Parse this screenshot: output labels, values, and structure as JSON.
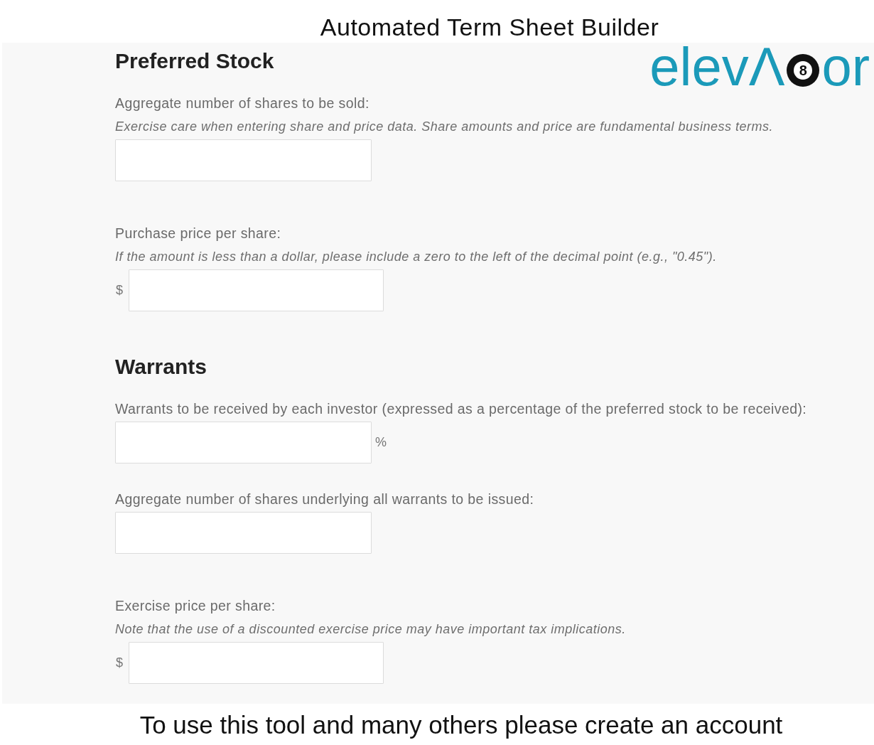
{
  "header": {
    "title": "Automated Term Sheet Builder"
  },
  "logo": {
    "text_start": "elevΛ",
    "ball_label": "8",
    "text_end": "or"
  },
  "sections": [
    {
      "heading": "Preferred Stock",
      "fields": [
        {
          "label": "Aggregate number of shares to be sold:",
          "hint": "Exercise care when entering share and price data. Share amounts and price are fundamental business terms."
        },
        {
          "label": "Purchase price per share:",
          "hint": "If the amount is less than a dollar, please include a zero to the left of the decimal point (e.g., \"0.45\").",
          "prefix": "$"
        }
      ]
    },
    {
      "heading": "Warrants",
      "fields": [
        {
          "label": "Warrants to be received by each investor (expressed as a percentage of the preferred stock to be received):",
          "suffix": "%"
        },
        {
          "label": "Aggregate number of shares underlying all warrants to be issued:"
        },
        {
          "label": "Exercise price per share:",
          "hint": "Note that the use of a discounted exercise price may have important tax implications.",
          "prefix": "$"
        }
      ]
    }
  ],
  "footer": {
    "text": "To use this tool and many others please create an account"
  }
}
